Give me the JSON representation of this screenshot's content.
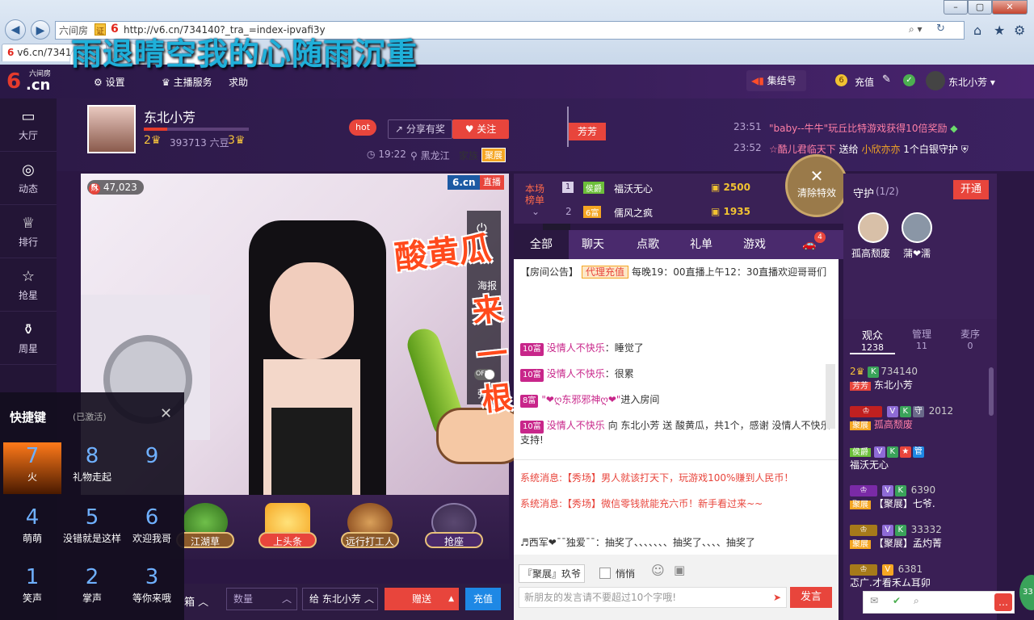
{
  "browser": {
    "url": "http://v6.cn/734140?_tra_=index-ipvafi3y",
    "addr_site_name": "六间房",
    "tab_title": "v6.cn/7341"
  },
  "nav": {
    "settings": "设置",
    "anchor_service": "主播服务",
    "help": "求助",
    "jiejie": "集结号",
    "recharge": "充值",
    "username": "东北小芳"
  },
  "sidebar": {
    "items": [
      {
        "label": "大厅",
        "icon": "tv-icon"
      },
      {
        "label": "动态",
        "icon": "compass-icon"
      },
      {
        "label": "排行",
        "icon": "crown-icon"
      },
      {
        "label": "抢星",
        "icon": "star-icon"
      },
      {
        "label": "周星",
        "icon": "gift-icon"
      }
    ],
    "logo_text": "六间房",
    "logo_main": "6.cn"
  },
  "overlay_text": "雨退晴空我的心随雨沉重",
  "room": {
    "anchor_name": "东北小芳",
    "hot": "hot",
    "share": "分享有奖",
    "follow": "关注",
    "level_left": "2",
    "level_right": "3",
    "beans": "393713 六豆",
    "time": "19:22",
    "location": "黑龙江",
    "family_label": "家族",
    "family_tag": "聚展",
    "flag_name": "芳芳",
    "wealth": "47,023",
    "wealth_tag": "财",
    "brand": "6.cn",
    "live": "直播"
  },
  "events": [
    {
      "time": "23:51",
      "text": "\"baby--牛牛\"玩丘比特游戏获得10倍奖励"
    },
    {
      "time": "23:52",
      "pre": "☆酷",
      "user": "儿君临天下",
      "mid": "送给",
      "target": "小欣亦亦",
      "text": "1个白银守护"
    }
  ],
  "rank": {
    "title1": "本场",
    "title2": "榜单",
    "rows": [
      {
        "no": "1",
        "badge": "侯爵",
        "name": "福沃无心",
        "score": "2500"
      },
      {
        "no": "2",
        "badge": "6富",
        "name": "儒风之疯",
        "score": "1935"
      }
    ],
    "clear_fx": "清除特效"
  },
  "chat_tabs": [
    "全部",
    "聊天",
    "点歌",
    "礼单",
    "游戏"
  ],
  "car_count": "4",
  "video_side": [
    "海报",
    "弹幕"
  ],
  "danmu_toggle": "OFF",
  "sticker": {
    "line1": "酸黄瓜",
    "line2": "来一根"
  },
  "chat": {
    "announce_tag": "【房间公告】",
    "announce_btn": "代理充值",
    "announce_text": "每晚19：00直播上午12：30直播欢迎哥哥们",
    "lines": [
      {
        "lvl": "10富",
        "user": "没情人不快乐",
        "sep": "：",
        "text": "睡觉了"
      },
      {
        "lvl": "10富",
        "user": "没情人不快乐",
        "sep": "：",
        "text": "很累"
      },
      {
        "lvl": "8富",
        "user": "\"❤ღ东邪邪神ღ❤\"",
        "sep": "",
        "text": "进入房间"
      },
      {
        "lvl": "10富",
        "user": "没情人不快乐",
        "sep": " 向 ",
        "text": "东北小芳 送 酸黄瓜，共1个，感谢 没情人不快乐 支持!"
      }
    ],
    "partial_user": "没情人不快乐"
  },
  "system": [
    {
      "label": "系统消息:",
      "tag": "【秀场】",
      "text": "男人就该打天下，玩游戏100%赚到人民币！"
    },
    {
      "label": "系统消息:",
      "tag": "【秀场】",
      "text": "微信零钱就能充六币！新手看过来~~"
    }
  ],
  "lottery": {
    "user": "♬西军❤¯¯独爱¯¯",
    "text": "：抽奖了、、、、、、、抽奖了、、、、抽奖了"
  },
  "input": {
    "tag": "『聚展』玖爷",
    "quiet": "悄悄",
    "placeholder": "新朋友的发言请不要超过10个字哦!",
    "send": "发言"
  },
  "guard": {
    "title": "守护",
    "count": "(1/2)",
    "open": "开通",
    "members": [
      "孤高颓废",
      "蒲❤濡"
    ]
  },
  "audience": {
    "tabs": [
      {
        "label": "观众",
        "count": "1238"
      },
      {
        "label": "管理",
        "count": "11"
      },
      {
        "label": "麦序",
        "count": "0"
      }
    ],
    "users": [
      {
        "lvl": "2",
        "id": "734140",
        "tag": "芳芳",
        "name": "东北小芳"
      },
      {
        "lvl": "",
        "id": "2012",
        "tag": "聚展",
        "name": "孤高颓废"
      },
      {
        "lvl": "侯爵",
        "id": "",
        "tag": "",
        "name": "福沃无心"
      },
      {
        "lvl": "",
        "id": "6390",
        "tag": "聚展",
        "name": "【聚展】七爷."
      },
      {
        "lvl": "",
        "id": "33332",
        "tag": "聚展",
        "name": "【聚展】孟灼菁"
      },
      {
        "lvl": "",
        "id": "6381",
        "tag": "",
        "name": "忑广.才看禾ム耳卯"
      }
    ]
  },
  "hotkeys": {
    "title": "快捷键",
    "status": "(已激活)",
    "items": [
      {
        "num": "7",
        "label": "火"
      },
      {
        "num": "8",
        "label": "礼物走起"
      },
      {
        "num": "9",
        "label": ""
      },
      {
        "num": "4",
        "label": "萌萌"
      },
      {
        "num": "5",
        "label": "没错就是这样"
      },
      {
        "num": "6",
        "label": "欢迎我哥"
      },
      {
        "num": "1",
        "label": "笑声"
      },
      {
        "num": "2",
        "label": "掌声"
      },
      {
        "num": "3",
        "label": "等你来哦"
      }
    ]
  },
  "gifts": [
    "江湖草",
    "上头条",
    "远行打工人",
    "抢座"
  ],
  "bottom": {
    "box": "箱",
    "qty": "数量",
    "to": "给 东北小芳",
    "give": "赠送",
    "recharge": "充值"
  },
  "colors": {
    "accent": "#e8453c",
    "purple": "#3a1f55",
    "link": "#c8268a"
  }
}
